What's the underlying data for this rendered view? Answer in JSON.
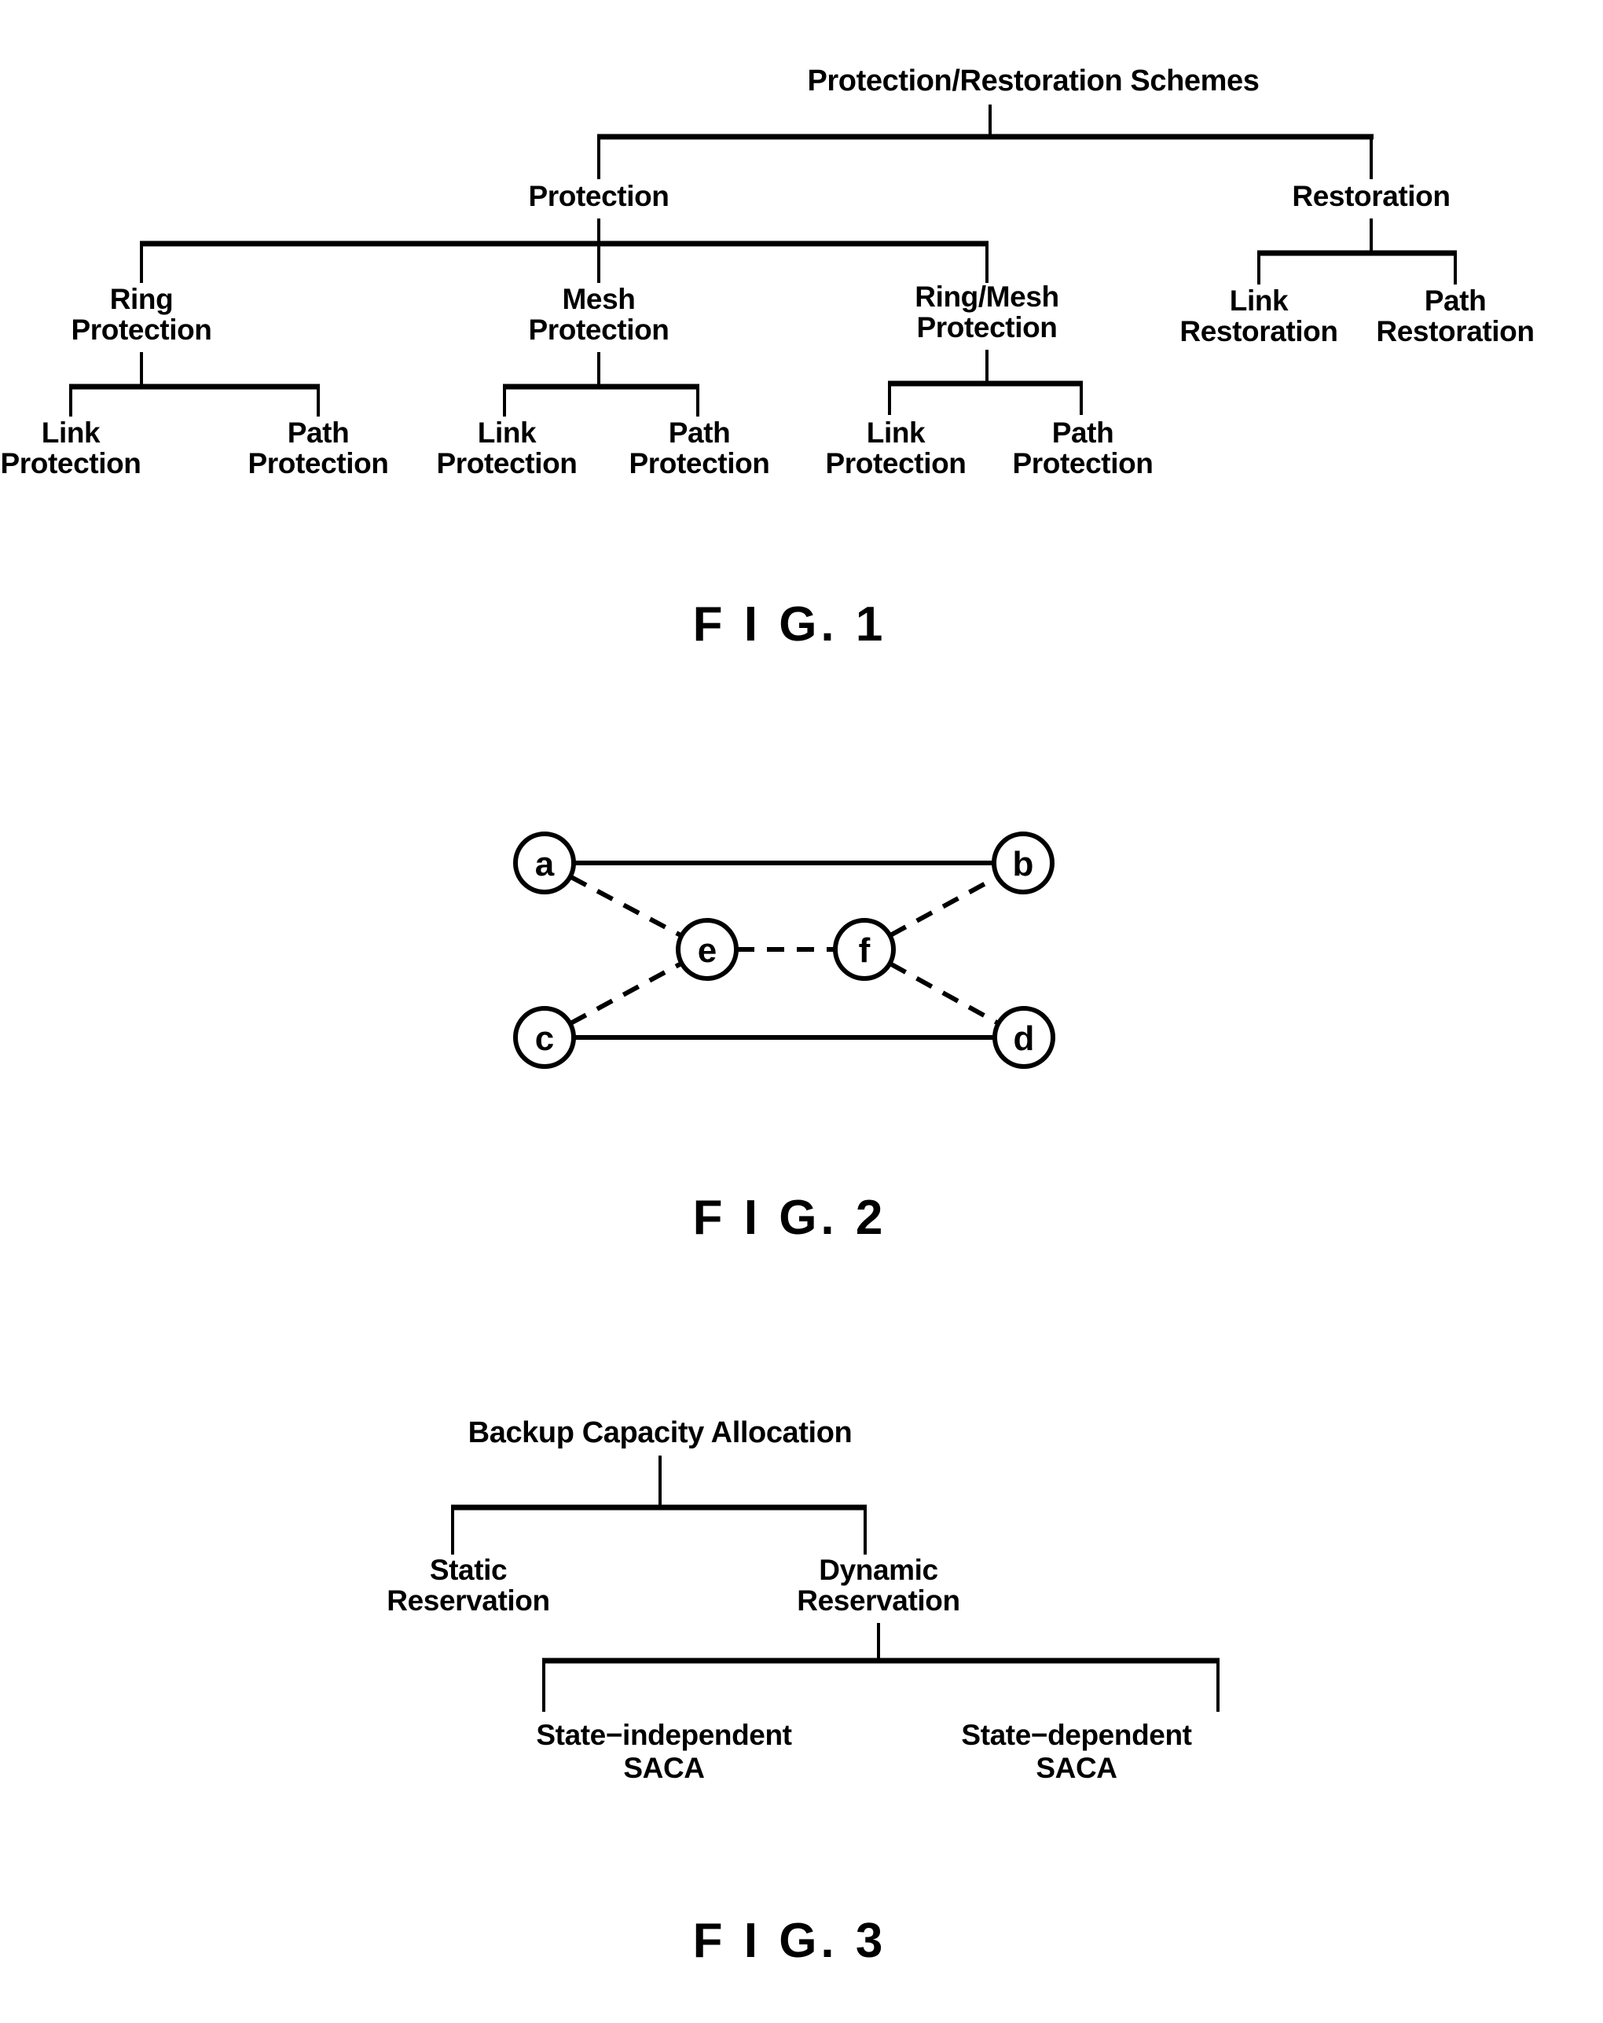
{
  "document": {
    "type": "patent-figure-sheet",
    "figure_count": 3
  },
  "figure1": {
    "caption": "F I G.   1",
    "caption_text": "FIG. 1",
    "root": "Protection/Restoration Schemes",
    "level1": {
      "protection": "Protection",
      "restoration": "Restoration"
    },
    "level2": {
      "ring_protection_line1": "Ring",
      "ring_protection_line2": "Protection",
      "mesh_protection_line1": "Mesh",
      "mesh_protection_line2": "Protection",
      "ring_mesh_protection_line1": "Ring/Mesh",
      "ring_mesh_protection_line2": "Protection",
      "link_restoration_line1": "Link",
      "link_restoration_line2": "Restoration",
      "path_restoration_line1": "Path",
      "path_restoration_line2": "Restoration"
    },
    "level3": {
      "ring_link_line1": "Link",
      "ring_link_line2": "Protection",
      "ring_path_line1": "Path",
      "ring_path_line2": "Protection",
      "mesh_link_line1": "Link",
      "mesh_link_line2": "Protection",
      "mesh_path_line1": "Path",
      "mesh_path_line2": "Protection",
      "ringmesh_link_line1": "Link",
      "ringmesh_link_line2": "Protection",
      "ringmesh_path_line1": "Path",
      "ringmesh_path_line2": "Protection"
    }
  },
  "figure2": {
    "caption": "F I G.   2",
    "caption_text": "FIG. 2",
    "nodes": {
      "a": "a",
      "b": "b",
      "c": "c",
      "d": "d",
      "e": "e",
      "f": "f"
    },
    "edges": [
      {
        "from": "a",
        "to": "b",
        "style": "solid"
      },
      {
        "from": "c",
        "to": "d",
        "style": "solid"
      },
      {
        "from": "a",
        "to": "e",
        "style": "dashed"
      },
      {
        "from": "c",
        "to": "e",
        "style": "dashed"
      },
      {
        "from": "e",
        "to": "f",
        "style": "dashed"
      },
      {
        "from": "f",
        "to": "b",
        "style": "dashed"
      },
      {
        "from": "f",
        "to": "d",
        "style": "dashed"
      }
    ]
  },
  "figure3": {
    "caption": "F I G.   3",
    "caption_text": "FIG. 3",
    "root": "Backup Capacity Allocation",
    "level1": {
      "static_line1": "Static",
      "static_line2": "Reservation",
      "dynamic_line1": "Dynamic",
      "dynamic_line2": "Reservation"
    },
    "level2": {
      "state_independent_line1": "State−independent",
      "state_independent_line2": "SACA",
      "state_dependent_line1": "State−dependent",
      "state_dependent_line2": "SACA"
    }
  },
  "colors": {
    "ink": "#000000",
    "paper": "#ffffff"
  }
}
